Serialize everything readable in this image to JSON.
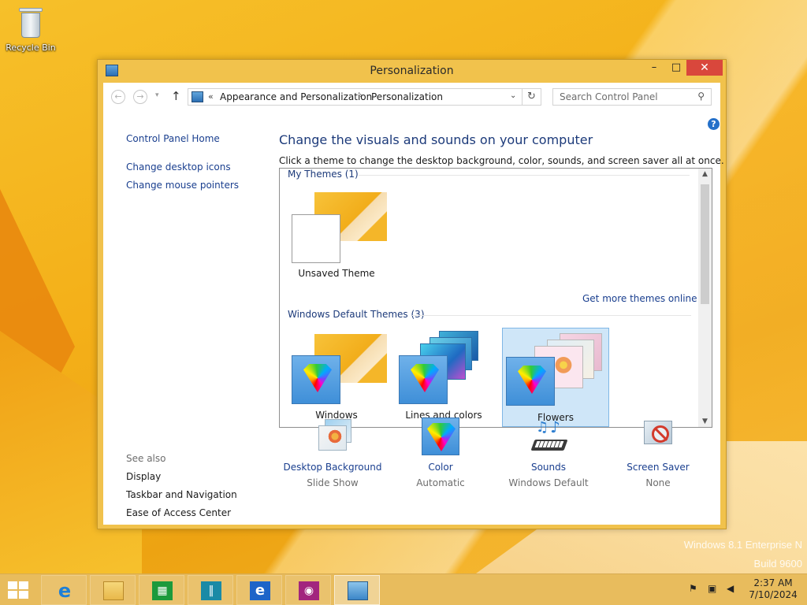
{
  "desktop": {
    "recycle_bin_label": "Recycle Bin",
    "watermark_line1": "Windows 8.1 Enterprise N",
    "watermark_line2": "Build 9600"
  },
  "window": {
    "title": "Personalization",
    "min_glyph": "–",
    "max_glyph": "□",
    "close_glyph": "✕"
  },
  "navbar": {
    "back_glyph": "←",
    "forward_glyph": "→",
    "recent_glyph": "▾",
    "up_glyph": "↑",
    "address_prefix": "«",
    "crumb1": "Appearance and Personalization",
    "crumb_sep": "›",
    "crumb2": "Personalization",
    "dropdown_glyph": "⌄",
    "refresh_glyph": "↻",
    "search_placeholder": "Search Control Panel",
    "search_icon": "⚲"
  },
  "leftpane": {
    "home": "Control Panel Home",
    "desktop_icons": "Change desktop icons",
    "mouse_pointers": "Change mouse pointers",
    "see_also": "See also",
    "display": "Display",
    "taskbar": "Taskbar and Navigation",
    "ease": "Ease of Access Center"
  },
  "main": {
    "help_glyph": "?",
    "title": "Change the visuals and sounds on your computer",
    "subtitle": "Click a theme to change the desktop background, color, sounds, and screen saver all at once.",
    "my_themes_header": "My Themes (1)",
    "unsaved_theme": "Unsaved Theme",
    "more_themes_link": "Get more themes online",
    "default_themes_header": "Windows Default Themes (3)",
    "themes": [
      "Windows",
      "Lines and colors",
      "Flowers"
    ],
    "selected_theme": "Flowers",
    "scroll_up": "▲",
    "scroll_down": "▼"
  },
  "bottom": {
    "items": [
      {
        "label": "Desktop Background",
        "sub": "Slide Show",
        "icon": "desktop-background-icon"
      },
      {
        "label": "Color",
        "sub": "Automatic",
        "icon": "color-icon"
      },
      {
        "label": "Sounds",
        "sub": "Windows Default",
        "icon": "sounds-icon"
      },
      {
        "label": "Screen Saver",
        "sub": "None",
        "icon": "screen-saver-icon"
      }
    ]
  },
  "taskbar": {
    "apps": [
      "Internet Explorer",
      "File Explorer",
      "Store",
      "Restaurant App",
      "Internet Explorer (Metro)",
      "Camera",
      "Control Panel"
    ],
    "time": "2:37 AM",
    "date": "7/10/2024"
  },
  "colors": {
    "accent_bg": "#f2a812",
    "window_frame": "#f1c24c",
    "link": "#1a3f8f",
    "close_red": "#d9473c",
    "selection": "#cfe6f8"
  }
}
